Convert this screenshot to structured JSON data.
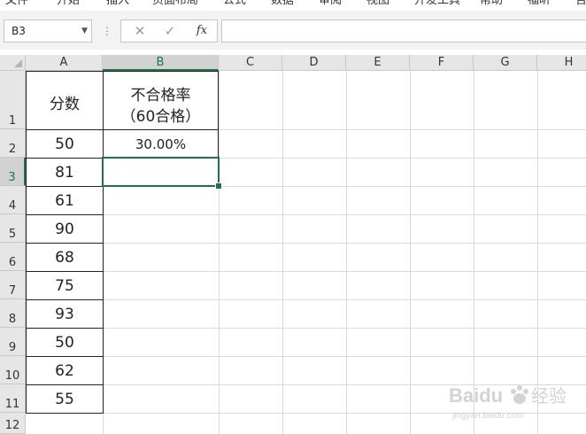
{
  "ribbon": {
    "tabs": [
      "文件",
      "开始",
      "插入",
      "页面布局",
      "公式",
      "数据",
      "审阅",
      "视图",
      "开发工具",
      "帮助",
      "福昕",
      "告"
    ]
  },
  "formula_bar": {
    "name_box": "B3",
    "cancel_icon": "✕",
    "enter_icon": "✓",
    "fx_label": "fx",
    "formula_value": ""
  },
  "columns": [
    "A",
    "B",
    "C",
    "D",
    "E",
    "F",
    "G",
    "H"
  ],
  "selected_column": "B",
  "rows": [
    "1",
    "2",
    "3",
    "4",
    "5",
    "6",
    "7",
    "8",
    "9",
    "10",
    "11",
    "12"
  ],
  "selected_row": "3",
  "table": {
    "header_a": "分数",
    "header_b_line1": "不合格率",
    "header_b_line2": "（60合格）",
    "scores": [
      "50",
      "81",
      "61",
      "90",
      "68",
      "75",
      "93",
      "50",
      "62",
      "55"
    ],
    "fail_rate": "30.00%"
  },
  "watermark": {
    "brand": "Baidu",
    "text": "经验",
    "url": "jingyan.baidu.com"
  },
  "colors": {
    "accent": "#217346",
    "header_bg": "#e6e6e6",
    "gridline": "#dadada"
  }
}
